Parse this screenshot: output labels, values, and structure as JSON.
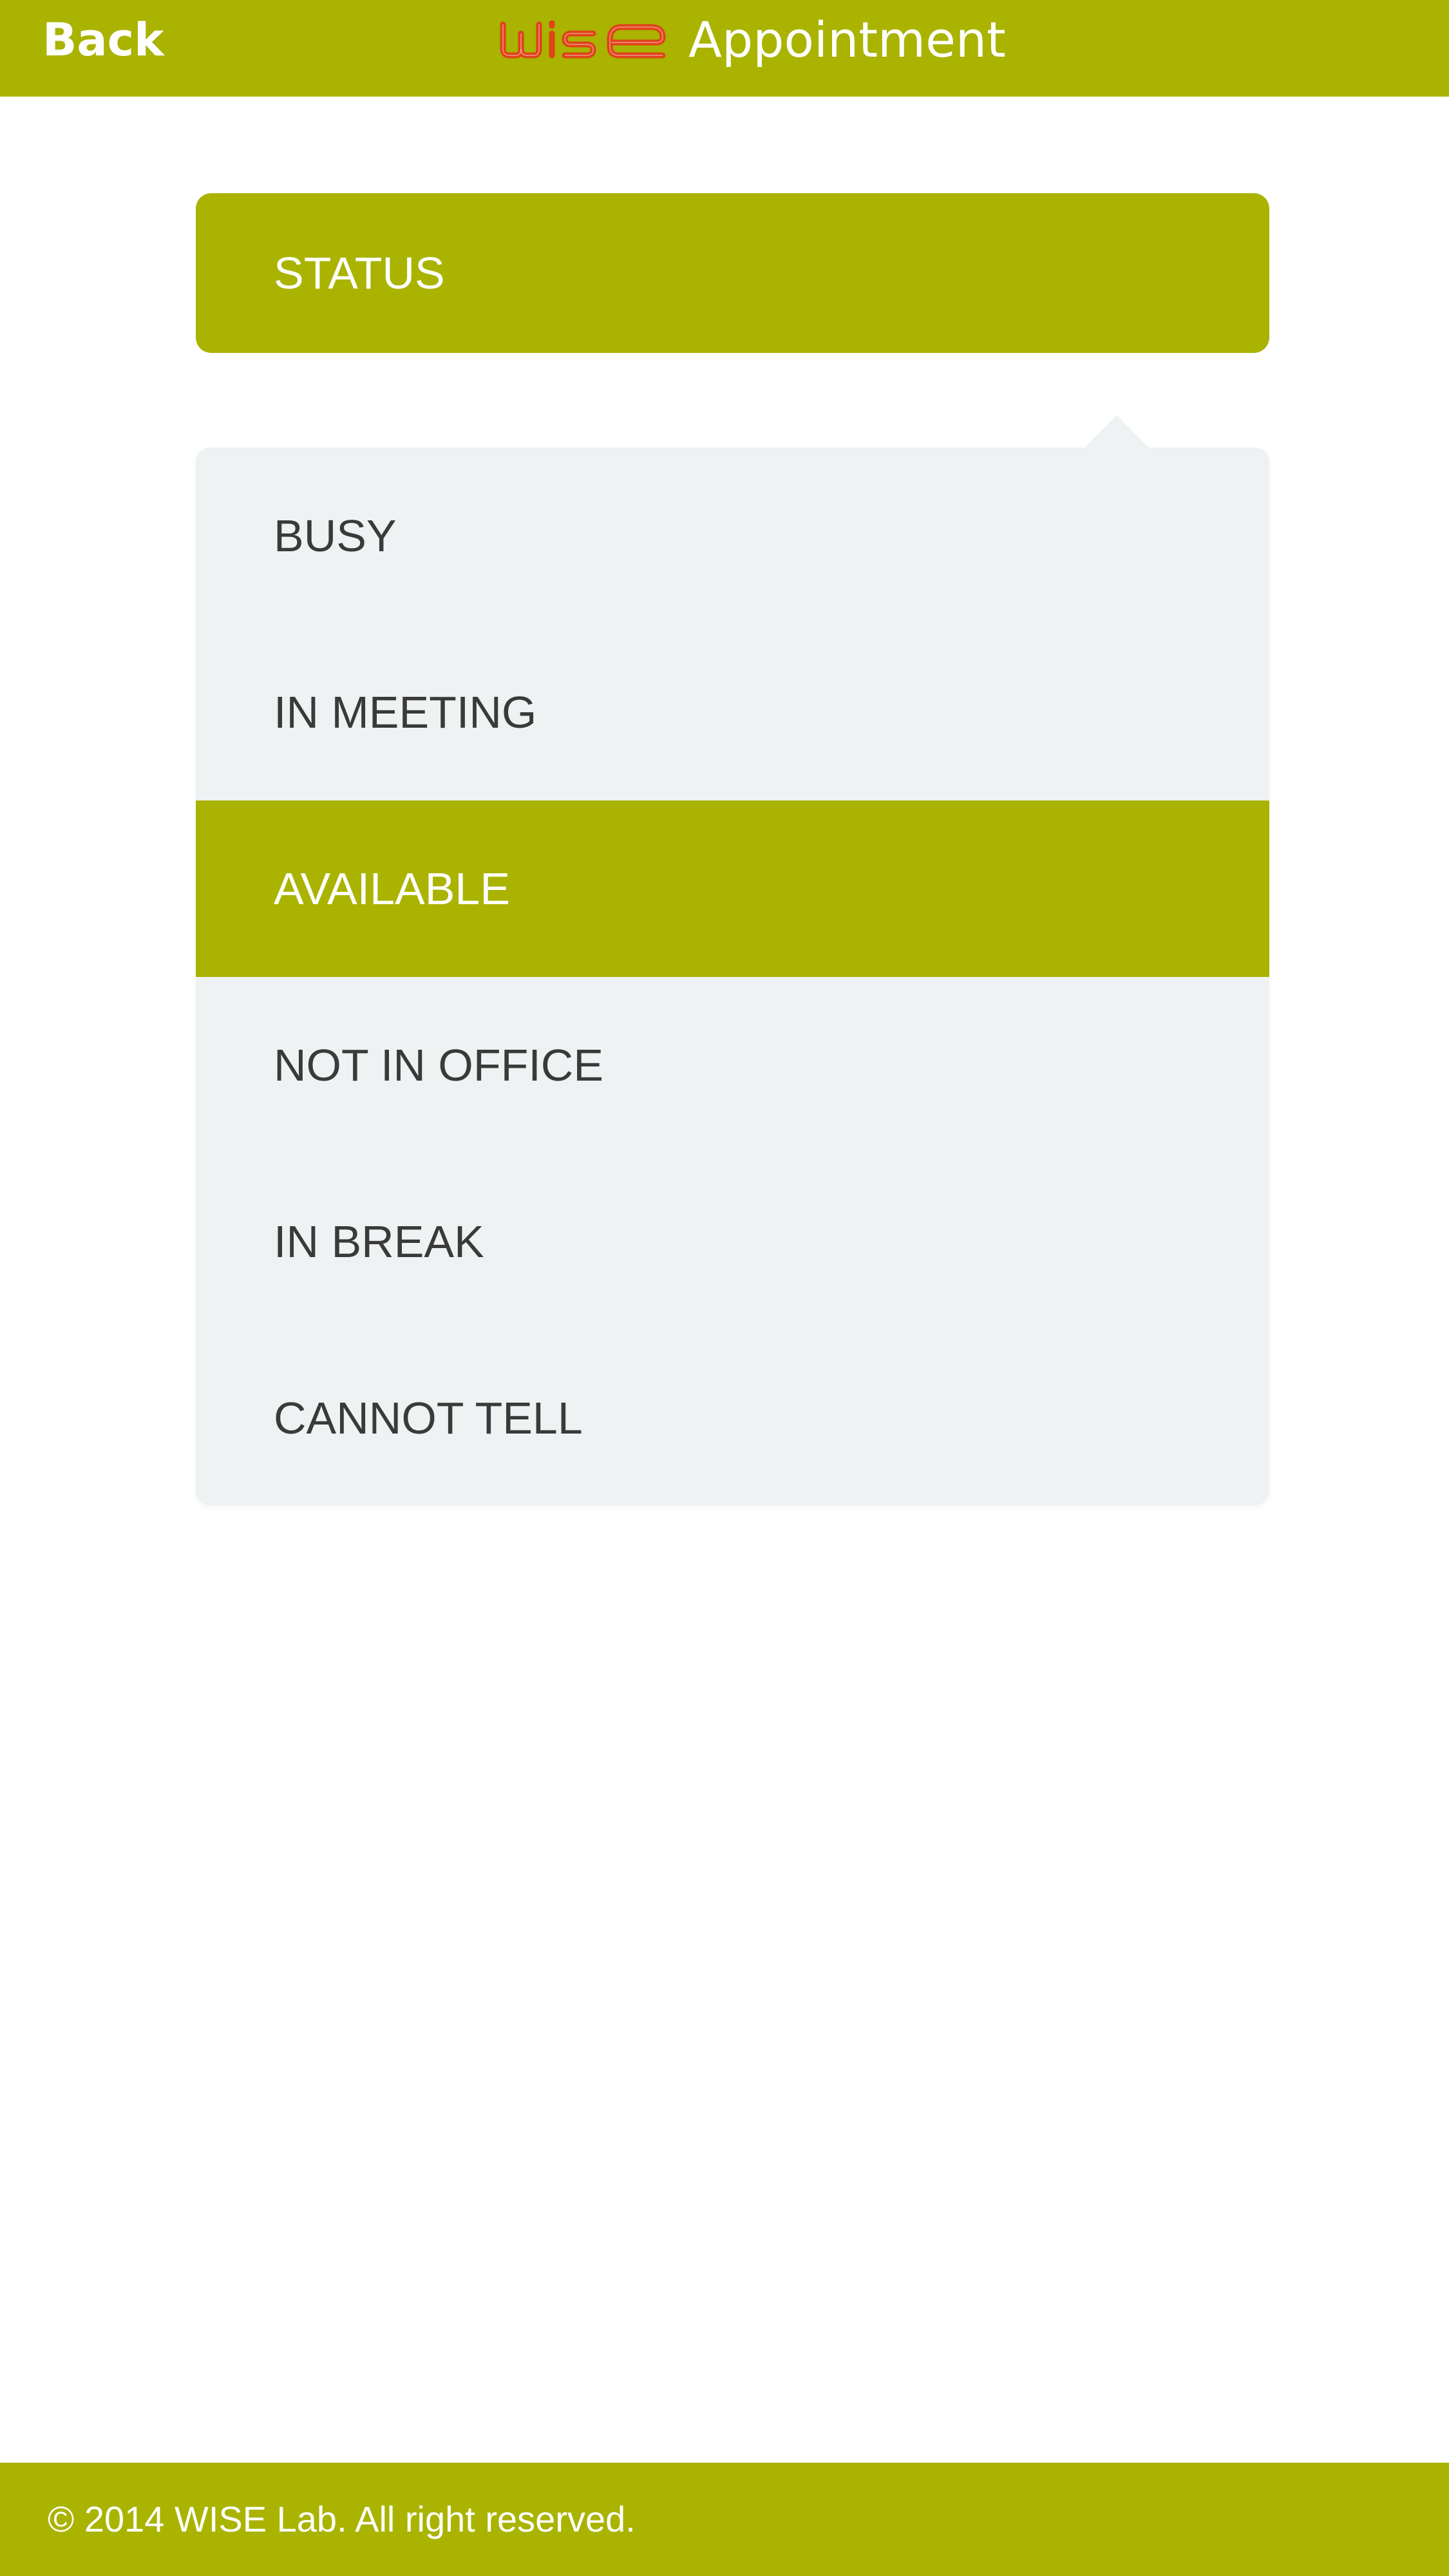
{
  "header": {
    "back_label": "Back",
    "logo_text": "WISE",
    "title": "Appointment"
  },
  "status": {
    "label": "STATUS"
  },
  "dropdown": {
    "options": [
      {
        "label": "BUSY",
        "selected": false
      },
      {
        "label": "IN MEETING",
        "selected": false
      },
      {
        "label": "AVAILABLE",
        "selected": true
      },
      {
        "label": "NOT IN OFFICE",
        "selected": false
      },
      {
        "label": "IN BREAK",
        "selected": false
      },
      {
        "label": "CANNOT TELL",
        "selected": false
      }
    ]
  },
  "footer": {
    "copyright": "© 2014 WISE Lab. All right reserved."
  },
  "colors": {
    "brand_green": "#a9b300",
    "logo_orange": "#e0421a",
    "dropdown_bg": "#eff2f3",
    "option_text": "#3a3a3a"
  }
}
